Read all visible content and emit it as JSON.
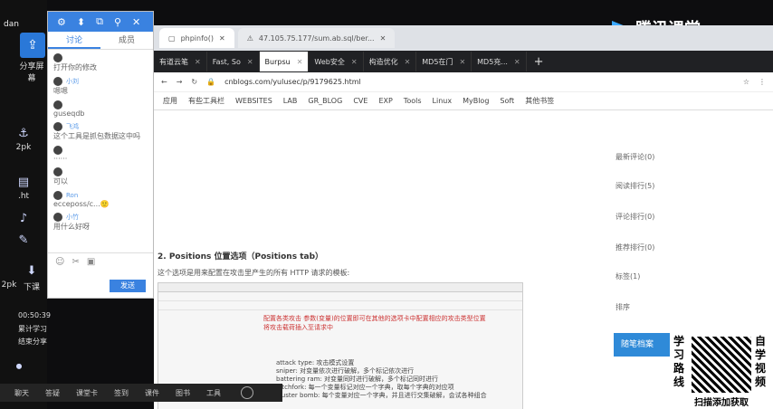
{
  "desktop": {
    "user": "dan",
    "share_label": "分享屏幕",
    "items": [
      {
        "glyph": "⚓",
        "label": "2pk"
      },
      {
        "glyph": "▤",
        "label": ".ht"
      },
      {
        "glyph": "♪",
        "label": ""
      },
      {
        "glyph": "✎",
        "label": ""
      },
      {
        "glyph": "⬇",
        "label": "下课"
      },
      {
        "glyph": "⏺",
        "label": ""
      }
    ],
    "left_labels": [
      "2pk",
      "2pk"
    ],
    "clock": "00:50:39",
    "status1": "累计学习",
    "status2": "结束分享"
  },
  "chat": {
    "tabs": [
      "讨论",
      "成员"
    ],
    "messages": [
      {
        "name": "",
        "text": "打开你的修改"
      },
      {
        "name": "小刘",
        "text": "嗯嗯"
      },
      {
        "name": "",
        "text": "guseqdb"
      },
      {
        "name": "飞鸿",
        "text": "这个工具是抓包数据这中吗"
      },
      {
        "name": "",
        "text": "······"
      },
      {
        "name": "",
        "text": "可以"
      },
      {
        "name": "Ron",
        "text": "ecceposs/c...🙂"
      },
      {
        "name": "小竹",
        "text": "用什么好呀"
      }
    ],
    "send": "发送"
  },
  "browser": {
    "top_tabs": [
      "phpinfo()",
      "47.105.75.177/sum.ab.sql/ber..."
    ],
    "tabs": [
      {
        "label": "有道云笔",
        "act": false
      },
      {
        "label": "Fast, So",
        "act": false
      },
      {
        "label": "Burpsu",
        "act": true
      },
      {
        "label": "Web安全",
        "act": false
      },
      {
        "label": "构造优化",
        "act": false
      },
      {
        "label": "MD5在门",
        "act": false
      },
      {
        "label": "MD5充...",
        "act": false
      }
    ],
    "url": "cnblogs.com/yulusec/p/9179625.html",
    "bookmarks": [
      "应用",
      "有些工具栏",
      "WEBSITES",
      "LAB",
      "GR_BLOG",
      "CVE",
      "EXP",
      "Tools",
      "Linux",
      "MyBlog",
      "Soft",
      "其他书签"
    ],
    "heading": "2. Positions 位置选项（Positions tab）",
    "para": "这个选项是用来配置在攻击里产生的所有 HTTP 请求的模板:",
    "shot_red1": "配置各类攻击 参数(变量)的位置即可在其他的选项卡中配置相应的攻击类型位置",
    "shot_red2": "将攻击载荷插入至请求中",
    "shot_lines": [
      "attack type: 攻击模式设置",
      "sniper: 对变量依次进行破解，多个标记依次进行",
      "battering ram: 对变量同时进行破解，多个标记同时进行",
      "pitchfork: 每一个变量标记对应一个字典，取每个字典的对应项",
      "cluster bomb: 每个变量对应一个字典，并且进行交集破解，会试各种组合"
    ],
    "sidebar": [
      "最新评论(0)",
      "阅读排行(5)",
      "评论排行(0)",
      "推荐排行(0)",
      "标签(1)",
      "排序"
    ],
    "recommend": "随笔档案"
  },
  "brand": "腾讯课堂",
  "qr": {
    "left": "学习路线",
    "right": "自学视频",
    "caption": "扫描添加获取"
  },
  "taskbar": [
    "聊天",
    "答疑",
    "课堂卡",
    "签到",
    "课件",
    "图书",
    "工具"
  ]
}
